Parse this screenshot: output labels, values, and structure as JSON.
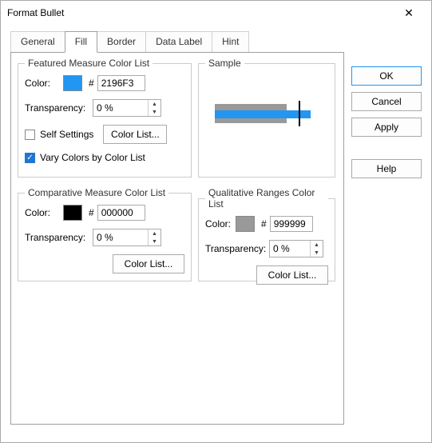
{
  "window": {
    "title": "Format Bullet"
  },
  "tabs": [
    "General",
    "Fill",
    "Border",
    "Data Label",
    "Hint"
  ],
  "featured": {
    "legend": "Featured Measure Color List",
    "colorLabel": "Color:",
    "hashLabel": "#",
    "hex": "2196F3",
    "swatch": "#2196F3",
    "transparencyLabel": "Transparency:",
    "transparency": "0 %",
    "selfSettings": "Self Settings",
    "colorListBtn": "Color List...",
    "varyColors": "Vary Colors by Color List"
  },
  "sample": {
    "legend": "Sample"
  },
  "comparative": {
    "legend": "Comparative Measure Color List",
    "colorLabel": "Color:",
    "hashLabel": "#",
    "hex": "000000",
    "swatch": "#000000",
    "transparencyLabel": "Transparency:",
    "transparency": "0 %",
    "colorListBtn": "Color List..."
  },
  "qualitative": {
    "legend": "Qualitative Ranges Color List",
    "colorLabel": "Color:",
    "hashLabel": "#",
    "hex": "999999",
    "swatch": "#999999",
    "transparencyLabel": "Transparency:",
    "transparency": "0 %",
    "colorListBtn": "Color List..."
  },
  "buttons": {
    "ok": "OK",
    "cancel": "Cancel",
    "apply": "Apply",
    "help": "Help"
  }
}
